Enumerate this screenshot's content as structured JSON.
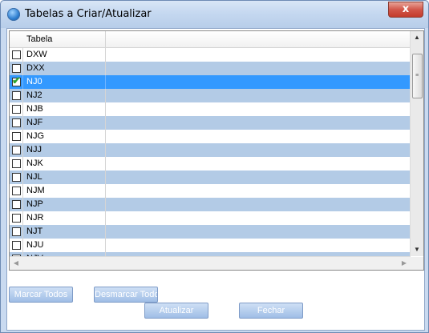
{
  "window": {
    "title": "Tabelas a Criar/Atualizar",
    "close_label": "x"
  },
  "grid": {
    "column_header": "Tabela",
    "rows": [
      {
        "name": "DXW",
        "checked": false,
        "selected": false
      },
      {
        "name": "DXX",
        "checked": false,
        "selected": false
      },
      {
        "name": "NJ0",
        "checked": true,
        "selected": true
      },
      {
        "name": "NJ2",
        "checked": false,
        "selected": false
      },
      {
        "name": "NJB",
        "checked": false,
        "selected": false
      },
      {
        "name": "NJF",
        "checked": false,
        "selected": false
      },
      {
        "name": "NJG",
        "checked": false,
        "selected": false
      },
      {
        "name": "NJJ",
        "checked": false,
        "selected": false
      },
      {
        "name": "NJK",
        "checked": false,
        "selected": false
      },
      {
        "name": "NJL",
        "checked": false,
        "selected": false
      },
      {
        "name": "NJM",
        "checked": false,
        "selected": false
      },
      {
        "name": "NJP",
        "checked": false,
        "selected": false
      },
      {
        "name": "NJR",
        "checked": false,
        "selected": false
      },
      {
        "name": "NJT",
        "checked": false,
        "selected": false
      },
      {
        "name": "NJU",
        "checked": false,
        "selected": false
      },
      {
        "name": "NJV",
        "checked": false,
        "selected": false
      }
    ]
  },
  "buttons": {
    "mark_all": "Marcar Todos",
    "unmark_all": "Desmarcar Todos",
    "update": "Atualizar",
    "close": "Fechar"
  },
  "colors": {
    "selection": "#3399ff",
    "alt_row": "#b3cbe6",
    "button_face": "#9fbde6"
  },
  "icons": {
    "checkbox_checked": "green-check-icon",
    "scroll_up": "triangle-up-icon",
    "scroll_down": "triangle-down-icon",
    "scroll_left": "triangle-left-icon",
    "scroll_right": "triangle-right-icon"
  }
}
